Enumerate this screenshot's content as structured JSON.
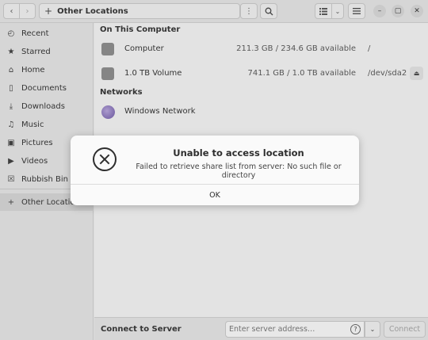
{
  "header": {
    "back_icon": "chevron-left-icon",
    "forward_icon": "chevron-right-icon",
    "path_label": "Other Locations",
    "path_icon": "plus-icon",
    "path_menu_icon": "vertical-dots-icon",
    "search_icon": "search-icon",
    "view_icon": "list-view-icon",
    "view_dropdown_icon": "chevron-down-icon",
    "menu_icon": "hamburger-icon",
    "window_controls": [
      "minimize-icon",
      "maximize-icon",
      "close-icon"
    ]
  },
  "sidebar": {
    "items": [
      {
        "label": "Recent",
        "icon": "clock-icon"
      },
      {
        "label": "Starred",
        "icon": "star-icon"
      },
      {
        "label": "Home",
        "icon": "home-icon"
      },
      {
        "label": "Documents",
        "icon": "document-icon"
      },
      {
        "label": "Downloads",
        "icon": "download-icon"
      },
      {
        "label": "Music",
        "icon": "music-icon"
      },
      {
        "label": "Pictures",
        "icon": "picture-icon"
      },
      {
        "label": "Videos",
        "icon": "video-icon"
      },
      {
        "label": "Rubbish Bin",
        "icon": "trash-icon"
      },
      {
        "label": "Other Locations",
        "icon": "plus-icon",
        "selected": true
      }
    ]
  },
  "main": {
    "on_this_computer_title": "On This Computer",
    "computer": {
      "name": "Computer",
      "available": "211.3 GB / 234.6 GB available",
      "mount": "/"
    },
    "volume": {
      "name": "1.0 TB Volume",
      "available": "741.1 GB / 1.0 TB available",
      "mount": "/dev/sda2",
      "eject_icon": "eject-icon"
    },
    "networks_title": "Networks",
    "network": {
      "name": "Windows Network",
      "icon": "network-globe-icon"
    }
  },
  "connect": {
    "label": "Connect to Server",
    "placeholder": "Enter server address…",
    "help_icon": "question-icon",
    "dropdown_icon": "chevron-down-icon",
    "button_label": "Connect"
  },
  "dialog": {
    "icon": "error-circle-icon",
    "title": "Unable to access location",
    "message": "Failed to retrieve share list from server: No such file or directory",
    "ok_label": "OK"
  },
  "colors": {
    "dialog_bg": "#fafafa",
    "sidebar_bg": "#ebebeb",
    "selected_bg": "#dadada",
    "disabled_text": "#a6a6a6"
  }
}
